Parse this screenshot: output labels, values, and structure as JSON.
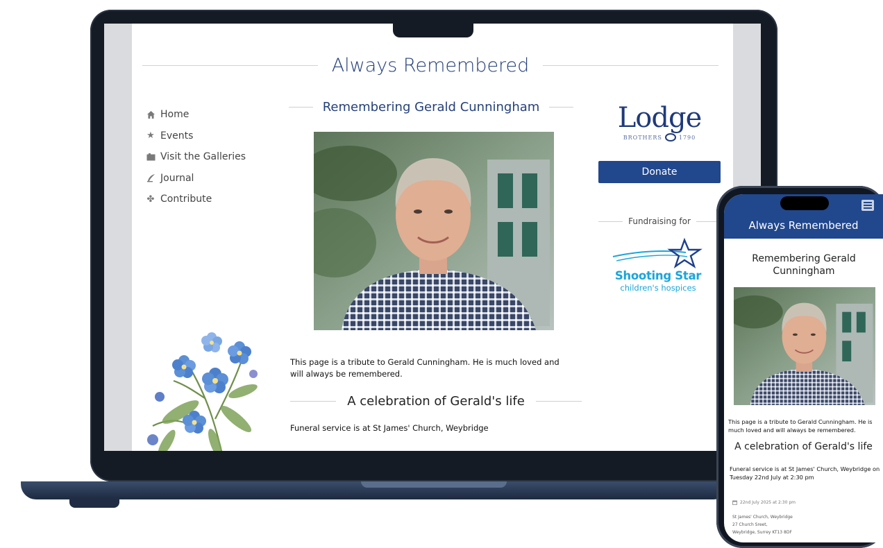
{
  "site": {
    "title": "Always Remembered"
  },
  "nav": {
    "items": [
      {
        "label": "Home",
        "icon": "home-icon"
      },
      {
        "label": "Events",
        "icon": "star-icon"
      },
      {
        "label": "Visit the Galleries",
        "icon": "gallery-icon"
      },
      {
        "label": "Journal",
        "icon": "quill-icon"
      },
      {
        "label": "Contribute",
        "icon": "flower-icon"
      }
    ]
  },
  "main": {
    "heading": "Remembering Gerald Cunningham",
    "tribute": "This page is a tribute to Gerald Cunningham. He is much loved and will always be remembered.",
    "celebration_heading": "A celebration of Gerald's life",
    "funeral": "Funeral service is at St James' Church, Weybridge"
  },
  "sidebar_right": {
    "logo_word": "Lodge",
    "logo_sub": "BROTHERS",
    "logo_year": "1790",
    "donate_label": "Donate",
    "fundraising_label": "Fundraising for",
    "charity_name": "Shooting Star",
    "charity_sub": "children's hospices"
  },
  "phone": {
    "title": "Always Remembered",
    "heading": "Remembering Gerald Cunningham",
    "tribute": "This page is a tribute to Gerald Cunningham. He is much loved and will always be remembered.",
    "celebration_heading": "A celebration of Gerald's life",
    "funeral": "Funeral service is at St James' Church, Weybridge on Tuesday 22nd July at 2:30 pm",
    "date": "22nd July 2025 at 2:30 pm",
    "address": [
      "St James' Church, Weybridge",
      "27 Church Sreet,",
      "Weybridge, Surrey KT13 8DF"
    ]
  },
  "colors": {
    "brand_blue": "#21478d",
    "title_blue": "#25407a",
    "charity_cyan": "#1aa5db"
  }
}
